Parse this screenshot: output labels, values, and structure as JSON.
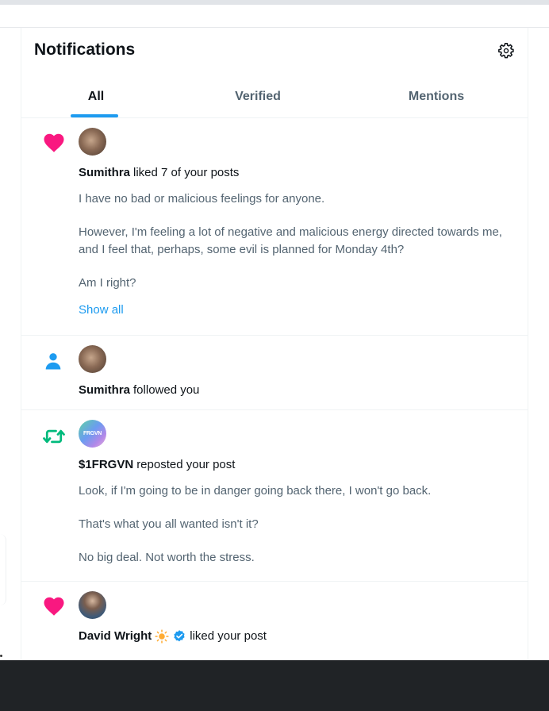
{
  "header": {
    "title": "Notifications",
    "settings_icon": "gear-icon"
  },
  "tabs": [
    {
      "label": "All",
      "active": true
    },
    {
      "label": "Verified",
      "active": false
    },
    {
      "label": "Mentions",
      "active": false
    }
  ],
  "notifications": [
    {
      "type": "like",
      "icon": "heart-icon",
      "actor": "Sumithra",
      "action": "liked 7 of your posts",
      "paragraphs": [
        "I have no bad or malicious feelings for anyone.",
        "However, I'm feeling a lot of negative and malicious energy directed towards me, and I feel that, perhaps, some evil is planned for Monday 4th?",
        "Am I right?"
      ],
      "show_all": "Show all"
    },
    {
      "type": "follow",
      "icon": "person-icon",
      "actor": "Sumithra",
      "action": "followed you"
    },
    {
      "type": "repost",
      "icon": "repost-icon",
      "actor": "$1FRGVN",
      "avatar_text": "FRGVN",
      "action": "reposted your post",
      "paragraphs": [
        "Look, if I'm going to be in danger going back there, I won't go back.",
        "That's what you all wanted isn't it?",
        "No big deal. Not worth the stress."
      ]
    },
    {
      "type": "like",
      "icon": "heart-icon",
      "actor": "David Wright",
      "action": "liked your post"
    }
  ],
  "colors": {
    "accent": "#1d9bf0",
    "like": "#f91880",
    "repost": "#00ba7c",
    "muted": "#536471",
    "text": "#0f1419"
  }
}
